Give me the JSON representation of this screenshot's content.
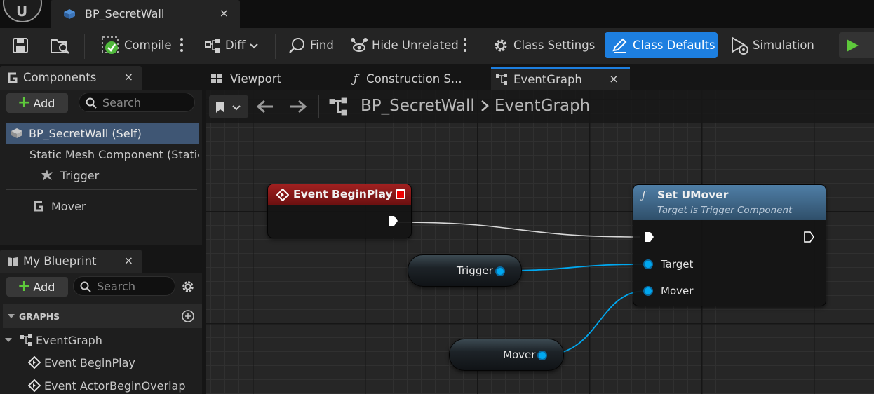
{
  "title_bar": {
    "document_tab": "BP_SecretWall",
    "close": "×"
  },
  "toolbar": {
    "compile": "Compile",
    "diff": "Diff",
    "find": "Find",
    "hide_unrelated": "Hide Unrelated",
    "class_settings": "Class Settings",
    "class_defaults": "Class Defaults",
    "simulation": "Simulation",
    "accent_color": "#1d7fe0"
  },
  "components_panel": {
    "title": "Components",
    "close": "×",
    "add": "Add",
    "search_placeholder": "Search",
    "items": [
      {
        "label": "BP_SecretWall (Self)"
      },
      {
        "label": "Static Mesh Component (StaticMeshComponent)"
      },
      {
        "label": "Trigger"
      },
      {
        "label": "Mover"
      }
    ]
  },
  "my_blueprint_panel": {
    "title": "My Blueprint",
    "close": "×",
    "add": "Add",
    "search_placeholder": "Search",
    "section": "GRAPHS",
    "graph": "EventGraph",
    "events": [
      "Event BeginPlay",
      "Event ActorBeginOverlap"
    ]
  },
  "graph_tabs": {
    "viewport": "Viewport",
    "construction": "Construction S...",
    "event_graph": "EventGraph",
    "close": "×"
  },
  "breadcrumb": {
    "blueprint": "BP_SecretWall",
    "graph": "EventGraph"
  },
  "nodes": {
    "begin_play": {
      "title": "Event BeginPlay",
      "header_color": "#8a1a1a"
    },
    "set_umover": {
      "title": "Set UMover",
      "subtitle": "Target is Trigger Component",
      "pins": {
        "target": "Target",
        "mover": "Mover"
      },
      "header_color": "#3f6585"
    },
    "trigger_var": {
      "label": "Trigger"
    },
    "mover_var": {
      "label": "Mover"
    }
  },
  "colors": {
    "object_pin": "#00a8f0",
    "exec_wire": "#e0e0e0",
    "selection": "#3f5674"
  }
}
